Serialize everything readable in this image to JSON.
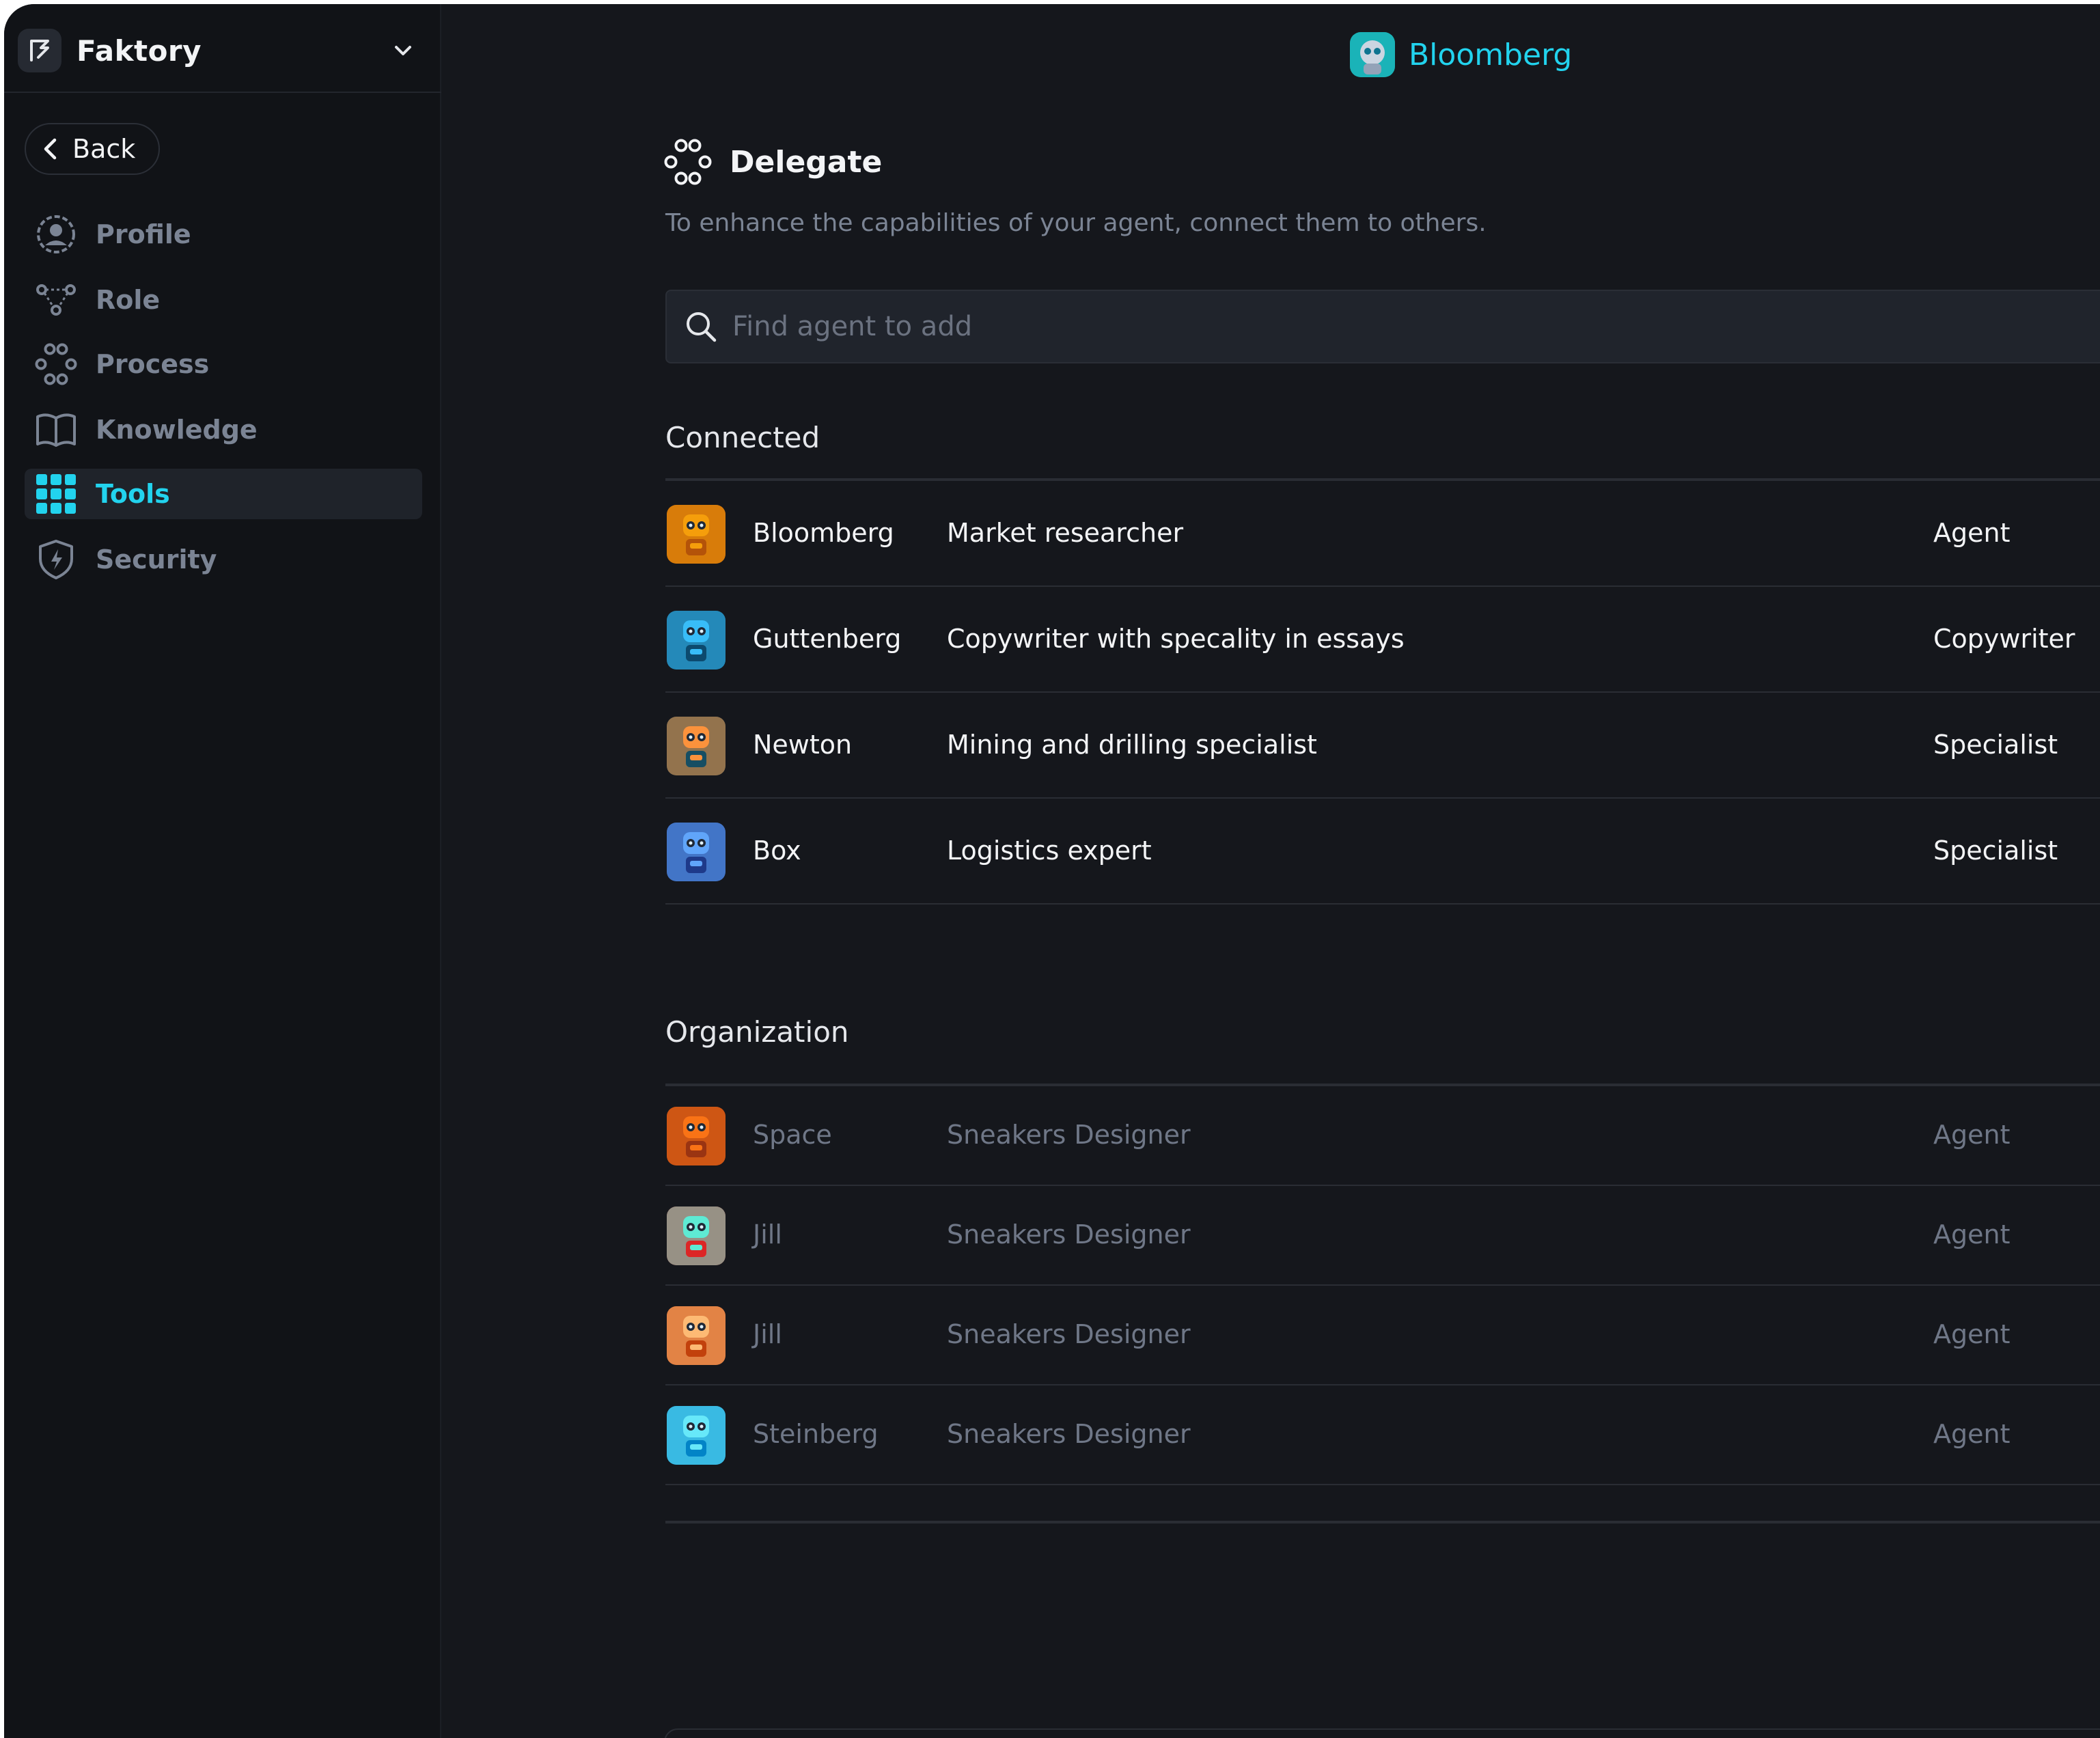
{
  "app": {
    "name": "Faktory"
  },
  "sidebar": {
    "back_label": "Back",
    "items": [
      {
        "label": "Profile",
        "icon": "profile-icon",
        "active": false
      },
      {
        "label": "Role",
        "icon": "role-icon",
        "active": false
      },
      {
        "label": "Process",
        "icon": "process-icon",
        "active": false
      },
      {
        "label": "Knowledge",
        "icon": "book-icon",
        "active": false
      },
      {
        "label": "Tools",
        "icon": "grid-icon",
        "active": true
      },
      {
        "label": "Security",
        "icon": "shield-icon",
        "active": false
      }
    ]
  },
  "header": {
    "agent_name": "Bloomberg"
  },
  "delegate": {
    "title": "Delegate",
    "description": "To enhance the capabilities of your agent, connect them to others.",
    "search_placeholder": "Find agent to add"
  },
  "connected": {
    "label": "Connected",
    "rows": [
      {
        "name": "Bloomberg",
        "description": "Market researcher",
        "kind": "Agent",
        "color_a": "#f59e0b",
        "color_b": "#b45309"
      },
      {
        "name": "Guttenberg",
        "description": "Copywriter with specality in essays",
        "kind": "Copywriter",
        "color_a": "#38bdf8",
        "color_b": "#0c4a6e"
      },
      {
        "name": "Newton",
        "description": "Mining and drilling specialist",
        "kind": "Specialist",
        "color_a": "#fb923c",
        "color_b": "#164e63"
      },
      {
        "name": "Box",
        "description": "Logistics expert",
        "kind": "Specialist",
        "color_a": "#60a5fa",
        "color_b": "#1e3a8a"
      }
    ]
  },
  "organization": {
    "label": "Organization",
    "rows": [
      {
        "name": "Space",
        "description": "Sneakers Designer",
        "kind": "Agent",
        "color_a": "#f97316",
        "color_b": "#9a3412"
      },
      {
        "name": "Jill",
        "description": "Sneakers Designer",
        "kind": "Agent",
        "color_a": "#5eead4",
        "color_b": "#dc2626"
      },
      {
        "name": "Jill",
        "description": "Sneakers Designer",
        "kind": "Agent",
        "color_a": "#fdba74",
        "color_b": "#c2410c"
      },
      {
        "name": "Steinberg",
        "description": "Sneakers Designer",
        "kind": "Agent",
        "color_a": "#67e8f9",
        "color_b": "#0284c7"
      }
    ]
  },
  "colors": {
    "accent": "#22d3ee",
    "background": "#15171c",
    "sidebar": "#111317",
    "muted_text": "#7b8494"
  }
}
